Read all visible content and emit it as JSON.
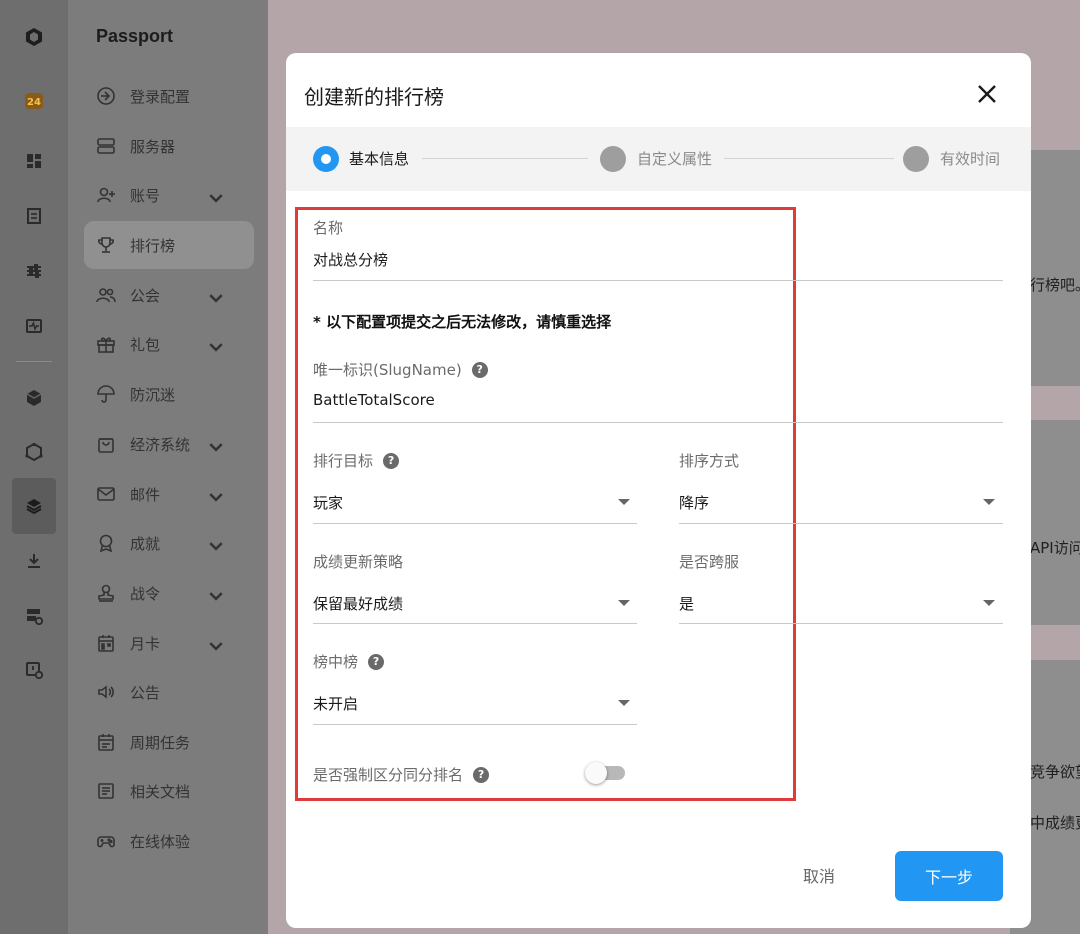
{
  "app": {
    "title": "Passport",
    "accent_color": "#2196f3",
    "highlight_color": "#e03a3a"
  },
  "rail": {
    "icons": [
      "cube-logo-icon",
      "app-24-logo-icon",
      "dashboard-icon",
      "document-icon",
      "sliders-icon",
      "monitor-pulse-icon",
      "box-icon",
      "hexagon-icon",
      "layers-icon",
      "download-icon",
      "server-settings-icon",
      "clock-settings-icon"
    ]
  },
  "nav": {
    "title": "Passport",
    "items": [
      {
        "label": "登录配置",
        "icon": "login-icon",
        "expandable": false,
        "active": false
      },
      {
        "label": "服务器",
        "icon": "server-icon",
        "expandable": false,
        "active": false
      },
      {
        "label": "账号",
        "icon": "user-add-icon",
        "expandable": true,
        "active": false
      },
      {
        "label": "排行榜",
        "icon": "trophy-icon",
        "expandable": false,
        "active": true
      },
      {
        "label": "公会",
        "icon": "group-icon",
        "expandable": true,
        "active": false
      },
      {
        "label": "礼包",
        "icon": "gift-icon",
        "expandable": true,
        "active": false
      },
      {
        "label": "防沉迷",
        "icon": "umbrella-icon",
        "expandable": false,
        "active": false
      },
      {
        "label": "经济系统",
        "icon": "shop-bag-icon",
        "expandable": true,
        "active": false
      },
      {
        "label": "邮件",
        "icon": "mail-icon",
        "expandable": true,
        "active": false
      },
      {
        "label": "成就",
        "icon": "award-icon",
        "expandable": true,
        "active": false
      },
      {
        "label": "战令",
        "icon": "stamp-icon",
        "expandable": true,
        "active": false
      },
      {
        "label": "月卡",
        "icon": "calendar-icon",
        "expandable": true,
        "active": false
      },
      {
        "label": "公告",
        "icon": "speaker-icon",
        "expandable": false,
        "active": false
      },
      {
        "label": "周期任务",
        "icon": "calendar-check-icon",
        "expandable": false,
        "active": false
      },
      {
        "label": "相关文档",
        "icon": "doc-icon",
        "expandable": false,
        "active": false
      },
      {
        "label": "在线体验",
        "icon": "gamepad-icon",
        "expandable": false,
        "active": false
      }
    ]
  },
  "background": {
    "snippets": [
      "行榜吧。",
      "API访问",
      "竞争欲望",
      "中成绩更"
    ]
  },
  "dialog": {
    "title": "创建新的排行榜",
    "steps": [
      {
        "label": "基本信息",
        "state": "active"
      },
      {
        "label": "自定义属性",
        "state": "pending"
      },
      {
        "label": "有效时间",
        "state": "pending"
      }
    ],
    "fields": {
      "name": {
        "label": "名称",
        "value": "对战总分榜"
      },
      "warning": "* 以下配置项提交之后无法修改，请慎重选择",
      "slug": {
        "label": "唯一标识(SlugName)",
        "value": "BattleTotalScore"
      },
      "target": {
        "label": "排行目标",
        "value": "玩家"
      },
      "order": {
        "label": "排序方式",
        "value": "降序"
      },
      "strategy": {
        "label": "成绩更新策略",
        "value": "保留最好成绩"
      },
      "cross_server": {
        "label": "是否跨服",
        "value": "是"
      },
      "sub_board": {
        "label": "榜中榜",
        "value": "未开启"
      },
      "force_distinct": {
        "label": "是否强制区分同分排名",
        "enabled": false
      }
    },
    "buttons": {
      "cancel": "取消",
      "next": "下一步"
    }
  }
}
